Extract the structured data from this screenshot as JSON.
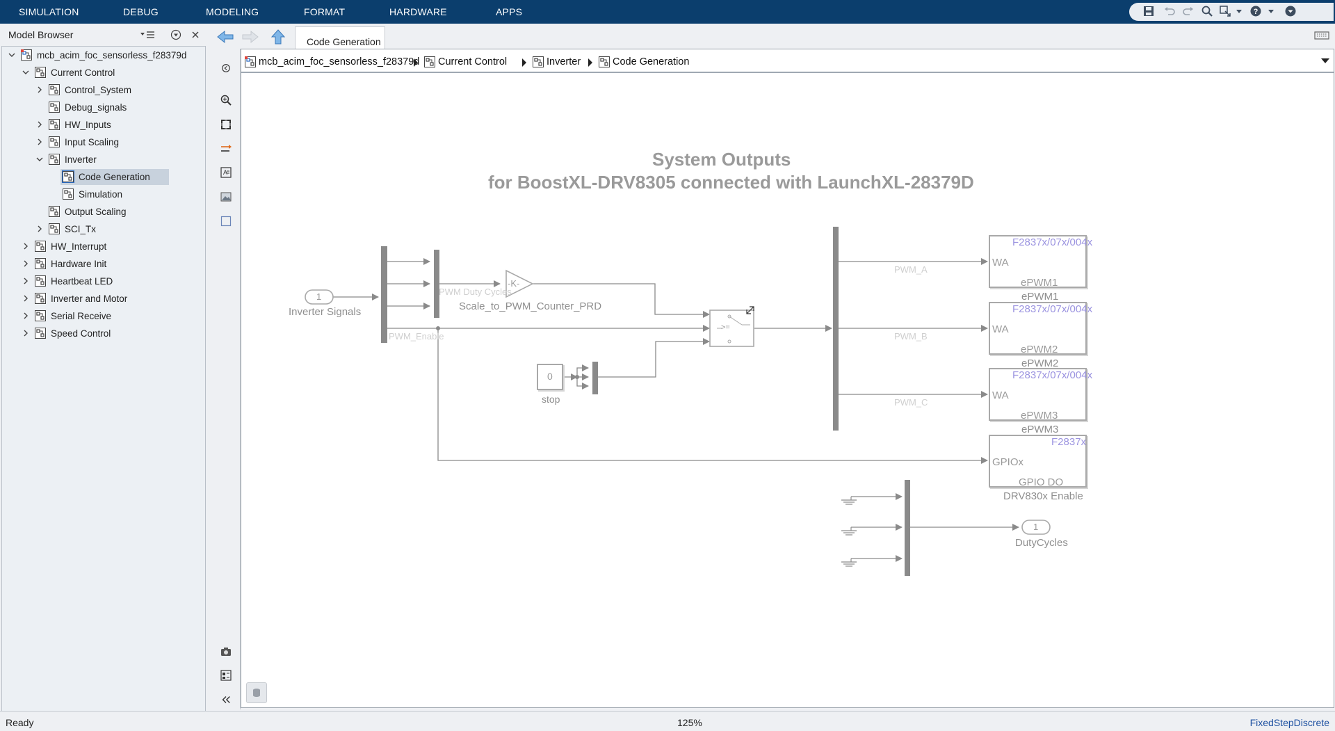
{
  "menubar": {
    "items": [
      "SIMULATION",
      "DEBUG",
      "MODELING",
      "FORMAT",
      "HARDWARE",
      "APPS"
    ],
    "quick_access_icons": [
      "save-icon",
      "undo-icon",
      "redo-icon",
      "find-icon",
      "expand-icon",
      "dropdown-icon",
      "help-icon",
      "dropdown-icon",
      "minimize-ribbon-icon"
    ]
  },
  "model_browser": {
    "title": "Model Browser",
    "tree": [
      {
        "label": "mcb_acim_foc_sensorless_f28379d",
        "level": 0,
        "state": "expanded",
        "icon": "model-icon"
      },
      {
        "label": "Current Control",
        "level": 1,
        "state": "expanded",
        "icon": "subsystem-icon"
      },
      {
        "label": "Control_System",
        "level": 2,
        "state": "collapsed",
        "icon": "subsystem-icon"
      },
      {
        "label": "Debug_signals",
        "level": 2,
        "state": "leaf",
        "icon": "subsystem-icon"
      },
      {
        "label": "HW_Inputs",
        "level": 2,
        "state": "collapsed",
        "icon": "subsystem-icon"
      },
      {
        "label": "Input Scaling",
        "level": 2,
        "state": "collapsed",
        "icon": "subsystem-icon"
      },
      {
        "label": "Inverter",
        "level": 2,
        "state": "expanded",
        "icon": "subsystem-icon"
      },
      {
        "label": "Code Generation",
        "level": 3,
        "state": "leaf",
        "icon": "subsystem-icon",
        "selected": true
      },
      {
        "label": "Simulation",
        "level": 3,
        "state": "leaf",
        "icon": "subsystem-icon"
      },
      {
        "label": "Output Scaling",
        "level": 2,
        "state": "leaf",
        "icon": "subsystem-icon"
      },
      {
        "label": "SCI_Tx",
        "level": 2,
        "state": "collapsed",
        "icon": "subsystem-icon"
      },
      {
        "label": "HW_Interrupt",
        "level": 1,
        "state": "collapsed",
        "icon": "subsystem-icon"
      },
      {
        "label": "Hardware Init",
        "level": 1,
        "state": "collapsed",
        "icon": "subsystem-icon"
      },
      {
        "label": "Heartbeat LED",
        "level": 1,
        "state": "collapsed",
        "icon": "subsystem-icon"
      },
      {
        "label": "Inverter and Motor",
        "level": 1,
        "state": "collapsed",
        "icon": "subsystem-icon"
      },
      {
        "label": "Serial Receive",
        "level": 1,
        "state": "collapsed",
        "icon": "subsystem-icon"
      },
      {
        "label": "Speed Control",
        "level": 1,
        "state": "collapsed",
        "icon": "subsystem-icon"
      }
    ]
  },
  "editor": {
    "tab_label": "Code Generation",
    "breadcrumb": [
      "mcb_acim_foc_sensorless_f28379d",
      "Current Control",
      "Inverter",
      "Code Generation"
    ]
  },
  "diagram": {
    "title_line1": "System Outputs",
    "title_line2": "for BoostXL-DRV8305 connected with LaunchXL-28379D",
    "inport": {
      "number": "1",
      "label": "Inverter Signals"
    },
    "signal_labels": {
      "pwm_duty_cycles": "PWM Duty Cycles",
      "pwm_enable": "PWM_Enable",
      "pwm_a": "PWM_A",
      "pwm_b": "PWM_B",
      "pwm_c": "PWM_C"
    },
    "gain": {
      "text": "-K-",
      "label": "Scale_to_PWM_Counter_PRD"
    },
    "switch": {
      "text": ">="
    },
    "constant": {
      "value": "0",
      "label": "stop"
    },
    "epwm_blocks": [
      {
        "header": "F2837x/07x/004x",
        "port": "WA",
        "inner": "ePWM1",
        "label": "ePWM1"
      },
      {
        "header": "F2837x/07x/004x",
        "port": "WA",
        "inner": "ePWM2",
        "label": "ePWM2"
      },
      {
        "header": "F2837x/07x/004x",
        "port": "WA",
        "inner": "ePWM3",
        "label": "ePWM3"
      }
    ],
    "gpio_block": {
      "header": "F2837x",
      "port": "GPIOx",
      "inner": "GPIO DO",
      "label": "DRV830x Enable"
    },
    "outport": {
      "number": "1",
      "label": "DutyCycles"
    }
  },
  "status": {
    "left": "Ready",
    "center": "125%",
    "right": "FixedStepDiscrete"
  },
  "colors": {
    "menubar": "#0b3e6d",
    "diagram_gray": "#8a8a8a",
    "target_blue": "#9b93e0",
    "solver_link": "#1b4fa0"
  }
}
